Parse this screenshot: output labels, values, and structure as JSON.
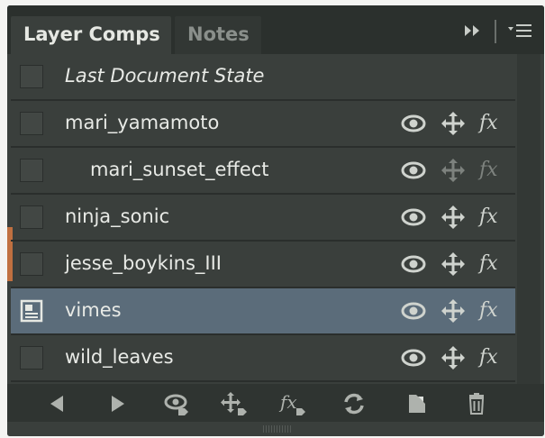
{
  "tabs": [
    {
      "label": "Layer Comps"
    },
    {
      "label": "Notes"
    }
  ],
  "rows": [
    {
      "name": "Last Document State",
      "italic": true,
      "indent": false,
      "selected": false,
      "icons": false
    },
    {
      "name": "mari_yamamoto",
      "italic": false,
      "indent": false,
      "selected": false,
      "icons": true,
      "dim_pos": false,
      "dim_fx": false
    },
    {
      "name": "mari_sunset_effect",
      "italic": false,
      "indent": true,
      "selected": false,
      "icons": true,
      "dim_pos": true,
      "dim_fx": true
    },
    {
      "name": "ninja_sonic",
      "italic": false,
      "indent": false,
      "selected": false,
      "icons": true,
      "dim_pos": false,
      "dim_fx": false
    },
    {
      "name": "jesse_boykins_III",
      "italic": false,
      "indent": false,
      "selected": false,
      "icons": true,
      "dim_pos": false,
      "dim_fx": false
    },
    {
      "name": "vimes",
      "italic": false,
      "indent": false,
      "selected": true,
      "icons": true,
      "dim_pos": false,
      "dim_fx": false
    },
    {
      "name": "wild_leaves",
      "italic": false,
      "indent": false,
      "selected": false,
      "icons": true,
      "dim_pos": false,
      "dim_fx": false
    }
  ],
  "icon_names": {
    "visibility": "eye-icon",
    "position": "move-arrows-icon",
    "appearance": "fx-icon"
  },
  "fx_text": "fx",
  "toolbar": [
    "previous-icon",
    "next-icon",
    "update-visibility-icon",
    "update-position-icon",
    "update-appearance-icon",
    "update-comp-icon",
    "new-comp-icon",
    "delete-icon"
  ],
  "colors": {
    "panel_bg": "#3a3f3c",
    "selected_row": "#5b6c7a",
    "text": "#e8eae6"
  }
}
